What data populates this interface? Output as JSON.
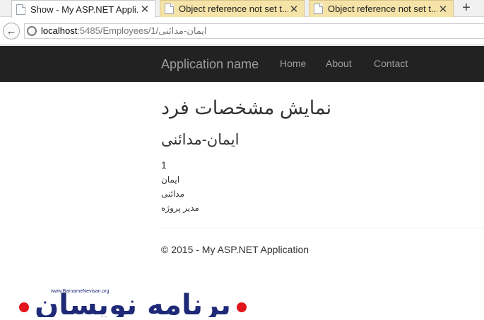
{
  "browser": {
    "tabs": [
      {
        "title": "Show - My ASP.NET Appli...",
        "close": "✕"
      },
      {
        "title": "Object reference not set t...",
        "close": "✕"
      },
      {
        "title": "Object reference not set t...",
        "close": "✕"
      }
    ],
    "new_tab": "+",
    "back": "←",
    "url_host": "localhost",
    "url_path": ":5485/Employees/1/ایمان-مدائنی"
  },
  "site": {
    "brand": "Application name",
    "nav": [
      "Home",
      "About",
      "Contact"
    ]
  },
  "page": {
    "heading": "نمایش مشخصات فرد",
    "subheading": "ایمان-مدائنی",
    "fields": [
      "1",
      "ایمان",
      "مدائنی",
      "مدیر پروژه"
    ],
    "footer": "© 2015 - My ASP.NET Application"
  },
  "watermark": {
    "site": "www.BarnameNevisan.org",
    "name": "برنامه نویسان"
  },
  "colors": {
    "navbar_bg": "#222222",
    "nav_text": "#9d9d9d",
    "logo_blue": "#1e2a78",
    "logo_red": "#e2141c"
  }
}
